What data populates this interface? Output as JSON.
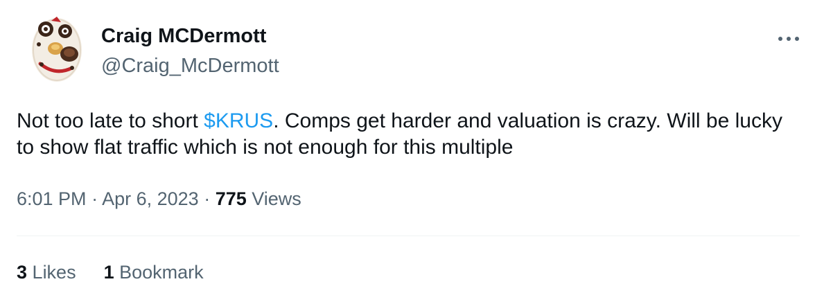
{
  "author": {
    "display_name": "Craig MCDermott",
    "handle": "@Craig_McDermott"
  },
  "more_icon": "ellipsis-icon",
  "tweet": {
    "text_before": "Not too late to short ",
    "cashtag": "$KRUS",
    "text_after": ". Comps get harder and valuation is crazy. Will be lucky to show flat traffic which is not enough for this multiple"
  },
  "meta": {
    "time": "6:01 PM",
    "separator": " · ",
    "date": "Apr 6, 2023",
    "views_count": "775",
    "views_label": "Views"
  },
  "stats": {
    "likes_count": "3",
    "likes_label": "Likes",
    "bookmarks_count": "1",
    "bookmarks_label": "Bookmark"
  },
  "colors": {
    "text_primary": "#0f1419",
    "text_secondary": "#536471",
    "link": "#1d9bf0",
    "divider": "#eff3f4"
  }
}
